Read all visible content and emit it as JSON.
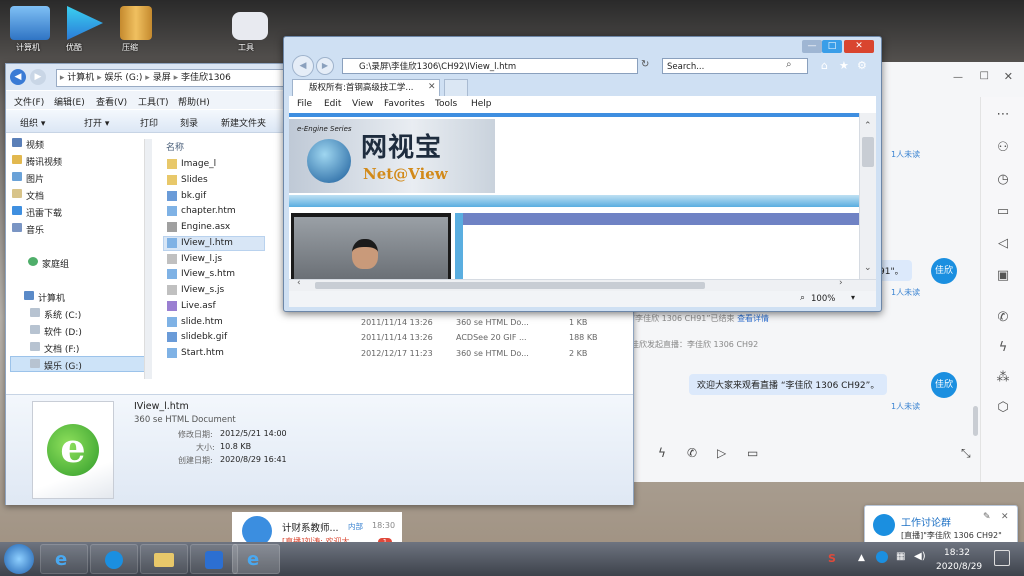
{
  "desktop": {
    "icons": [
      {
        "label": "计算机"
      },
      {
        "label": "优酷"
      },
      {
        "label": "压缩"
      },
      {
        "label": "工具"
      }
    ]
  },
  "explorer": {
    "breadcrumb": [
      "计算机",
      "娱乐 (G:)",
      "录屏",
      "李佳欣1306"
    ],
    "menu": [
      "文件(F)",
      "编辑(E)",
      "查看(V)",
      "工具(T)",
      "帮助(H)"
    ],
    "commands": [
      "组织 ▾",
      "打开 ▾",
      "打印",
      "刻录",
      "新建文件夹"
    ],
    "nav": [
      "视频",
      "腾讯视频",
      "图片",
      "文档",
      "迅雷下载",
      "音乐",
      "家庭组",
      "计算机",
      "系统 (C:)",
      "软件 (D:)",
      "文档 (F:)",
      "娱乐 (G:)"
    ],
    "column_name": "名称",
    "files": [
      {
        "name": "Image_l",
        "date": "",
        "type": "",
        "size": ""
      },
      {
        "name": "Slides",
        "date": "",
        "type": "",
        "size": ""
      },
      {
        "name": "bk.gif",
        "date": "",
        "type": "",
        "size": ""
      },
      {
        "name": "chapter.htm",
        "date": "",
        "type": "",
        "size": ""
      },
      {
        "name": "Engine.asx",
        "date": "",
        "type": "",
        "size": ""
      },
      {
        "name": "IView_l.htm",
        "date": "",
        "type": "",
        "size": ""
      },
      {
        "name": "IView_l.js",
        "date": "",
        "type": "",
        "size": ""
      },
      {
        "name": "IView_s.htm",
        "date": "",
        "type": "",
        "size": ""
      },
      {
        "name": "IView_s.js",
        "date": "",
        "type": "",
        "size": ""
      },
      {
        "name": "Live.asf",
        "date": "",
        "type": "",
        "size": ""
      },
      {
        "name": "slide.htm",
        "date": "2011/11/14 13:26",
        "type": "360 se HTML Do...",
        "size": "1 KB"
      },
      {
        "name": "slidebk.gif",
        "date": "2011/11/14 13:26",
        "type": "ACDSee 20 GIF ...",
        "size": "188 KB"
      },
      {
        "name": "Start.htm",
        "date": "2012/12/17 11:23",
        "type": "360 se HTML Do...",
        "size": "2 KB"
      }
    ],
    "details": {
      "filename": "IView_l.htm",
      "filetype": "360 se HTML Document",
      "modified_label": "修改日期:",
      "modified": "2012/5/21 14:00",
      "size_label": "大小:",
      "size": "10.8 KB",
      "created_label": "创建日期:",
      "created": "2020/8/29 16:41"
    }
  },
  "ie": {
    "url": "G:\\录屏\\李佳欣1306\\CH92\\IView_l.htm",
    "search_placeholder": "Search...",
    "tab_title": "版权所有:首钢高级技工学...",
    "menu": [
      "File",
      "Edit",
      "View",
      "Favorites",
      "Tools",
      "Help"
    ],
    "zoom": "100%",
    "page": {
      "brand_small": "e-Engine Series",
      "brand_cn": "网视宝",
      "brand_en": "Net@View"
    }
  },
  "chat": {
    "unread_label": "1人未读",
    "messages": [
      {
        "text": "91\"。"
      },
      {
        "text": "欢迎大家来观看直播 “李佳欣 1306 CH92”。"
      }
    ],
    "avatar_label": "佳欣",
    "sys1_prefix": "“李佳欣 1306 CH91”已结束",
    "sys1_link": "查看详情",
    "sys2": "佳欣发起直播：李佳欣 1306 CH92"
  },
  "chatlist": {
    "title": "计财系教师...",
    "tag": "内部",
    "time": "18:30",
    "preview": "[直播]刘涛: 欢迎大",
    "badge": "1"
  },
  "notification": {
    "title": "工作讨论群",
    "text": "[直播]\"李佳欣 1306 CH92\""
  },
  "taskbar": {
    "time": "18:32",
    "date": "2020/8/29"
  },
  "colors": {
    "accent": "#1b8fe0",
    "bubble": "#dce9fb",
    "ie_chrome": "#cfe0f3",
    "close_red": "#d9452f"
  }
}
